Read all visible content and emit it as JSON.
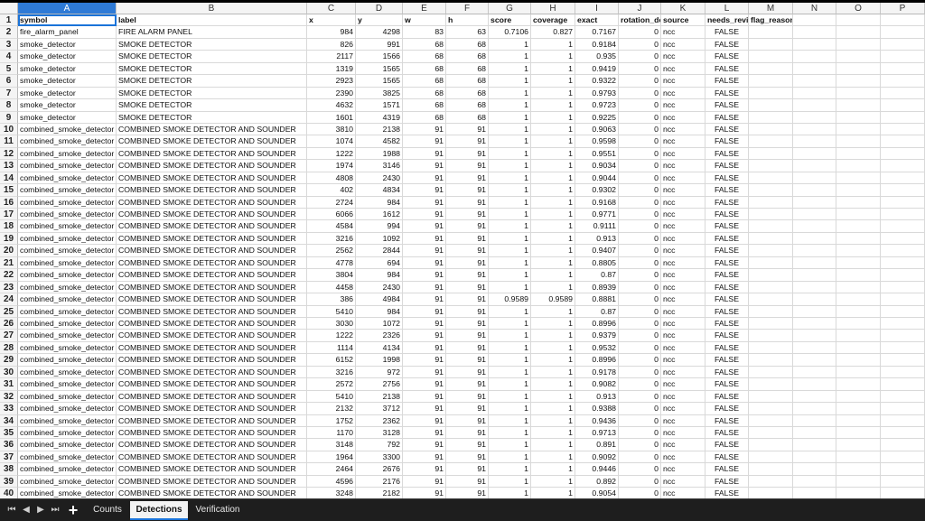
{
  "columns": [
    "A",
    "B",
    "C",
    "D",
    "E",
    "F",
    "G",
    "H",
    "I",
    "J",
    "K",
    "L",
    "M",
    "N",
    "O",
    "P"
  ],
  "selected_column": "A",
  "header_row": [
    "symbol",
    "label",
    "x",
    "y",
    "w",
    "h",
    "score",
    "coverage",
    "exact",
    "rotation_deg",
    "source",
    "needs_review",
    "flag_reason",
    "",
    "",
    ""
  ],
  "rows": [
    [
      "fire_alarm_panel",
      "FIRE ALARM PANEL",
      "984",
      "4298",
      "83",
      "63",
      "0.7106",
      "0.827",
      "0.7167",
      "0",
      "ncc",
      "FALSE"
    ],
    [
      "smoke_detector",
      "SMOKE DETECTOR",
      "826",
      "991",
      "68",
      "68",
      "1",
      "1",
      "0.9184",
      "0",
      "ncc",
      "FALSE"
    ],
    [
      "smoke_detector",
      "SMOKE DETECTOR",
      "2117",
      "1566",
      "68",
      "68",
      "1",
      "1",
      "0.935",
      "0",
      "ncc",
      "FALSE"
    ],
    [
      "smoke_detector",
      "SMOKE DETECTOR",
      "1319",
      "1565",
      "68",
      "68",
      "1",
      "1",
      "0.9419",
      "0",
      "ncc",
      "FALSE"
    ],
    [
      "smoke_detector",
      "SMOKE DETECTOR",
      "2923",
      "1565",
      "68",
      "68",
      "1",
      "1",
      "0.9322",
      "0",
      "ncc",
      "FALSE"
    ],
    [
      "smoke_detector",
      "SMOKE DETECTOR",
      "2390",
      "3825",
      "68",
      "68",
      "1",
      "1",
      "0.9793",
      "0",
      "ncc",
      "FALSE"
    ],
    [
      "smoke_detector",
      "SMOKE DETECTOR",
      "4632",
      "1571",
      "68",
      "68",
      "1",
      "1",
      "0.9723",
      "0",
      "ncc",
      "FALSE"
    ],
    [
      "smoke_detector",
      "SMOKE DETECTOR",
      "1601",
      "4319",
      "68",
      "68",
      "1",
      "1",
      "0.9225",
      "0",
      "ncc",
      "FALSE"
    ],
    [
      "combined_smoke_detector",
      "COMBINED SMOKE DETECTOR AND SOUNDER",
      "3810",
      "2138",
      "91",
      "91",
      "1",
      "1",
      "0.9063",
      "0",
      "ncc",
      "FALSE"
    ],
    [
      "combined_smoke_detector",
      "COMBINED SMOKE DETECTOR AND SOUNDER",
      "1074",
      "4582",
      "91",
      "91",
      "1",
      "1",
      "0.9598",
      "0",
      "ncc",
      "FALSE"
    ],
    [
      "combined_smoke_detector",
      "COMBINED SMOKE DETECTOR AND SOUNDER",
      "1222",
      "1988",
      "91",
      "91",
      "1",
      "1",
      "0.9551",
      "0",
      "ncc",
      "FALSE"
    ],
    [
      "combined_smoke_detector",
      "COMBINED SMOKE DETECTOR AND SOUNDER",
      "1974",
      "3146",
      "91",
      "91",
      "1",
      "1",
      "0.9034",
      "0",
      "ncc",
      "FALSE"
    ],
    [
      "combined_smoke_detector",
      "COMBINED SMOKE DETECTOR AND SOUNDER",
      "4808",
      "2430",
      "91",
      "91",
      "1",
      "1",
      "0.9044",
      "0",
      "ncc",
      "FALSE"
    ],
    [
      "combined_smoke_detector",
      "COMBINED SMOKE DETECTOR AND SOUNDER",
      "402",
      "4834",
      "91",
      "91",
      "1",
      "1",
      "0.9302",
      "0",
      "ncc",
      "FALSE"
    ],
    [
      "combined_smoke_detector",
      "COMBINED SMOKE DETECTOR AND SOUNDER",
      "2724",
      "984",
      "91",
      "91",
      "1",
      "1",
      "0.9168",
      "0",
      "ncc",
      "FALSE"
    ],
    [
      "combined_smoke_detector",
      "COMBINED SMOKE DETECTOR AND SOUNDER",
      "6066",
      "1612",
      "91",
      "91",
      "1",
      "1",
      "0.9771",
      "0",
      "ncc",
      "FALSE"
    ],
    [
      "combined_smoke_detector",
      "COMBINED SMOKE DETECTOR AND SOUNDER",
      "4584",
      "994",
      "91",
      "91",
      "1",
      "1",
      "0.9111",
      "0",
      "ncc",
      "FALSE"
    ],
    [
      "combined_smoke_detector",
      "COMBINED SMOKE DETECTOR AND SOUNDER",
      "3216",
      "1092",
      "91",
      "91",
      "1",
      "1",
      "0.913",
      "0",
      "ncc",
      "FALSE"
    ],
    [
      "combined_smoke_detector",
      "COMBINED SMOKE DETECTOR AND SOUNDER",
      "2562",
      "2844",
      "91",
      "91",
      "1",
      "1",
      "0.9407",
      "0",
      "ncc",
      "FALSE"
    ],
    [
      "combined_smoke_detector",
      "COMBINED SMOKE DETECTOR AND SOUNDER",
      "4778",
      "694",
      "91",
      "91",
      "1",
      "1",
      "0.8805",
      "0",
      "ncc",
      "FALSE"
    ],
    [
      "combined_smoke_detector",
      "COMBINED SMOKE DETECTOR AND SOUNDER",
      "3804",
      "984",
      "91",
      "91",
      "1",
      "1",
      "0.87",
      "0",
      "ncc",
      "FALSE"
    ],
    [
      "combined_smoke_detector",
      "COMBINED SMOKE DETECTOR AND SOUNDER",
      "4458",
      "2430",
      "91",
      "91",
      "1",
      "1",
      "0.8939",
      "0",
      "ncc",
      "FALSE"
    ],
    [
      "combined_smoke_detector",
      "COMBINED SMOKE DETECTOR AND SOUNDER",
      "386",
      "4984",
      "91",
      "91",
      "0.9589",
      "0.9589",
      "0.8881",
      "0",
      "ncc",
      "FALSE"
    ],
    [
      "combined_smoke_detector",
      "COMBINED SMOKE DETECTOR AND SOUNDER",
      "5410",
      "984",
      "91",
      "91",
      "1",
      "1",
      "0.87",
      "0",
      "ncc",
      "FALSE"
    ],
    [
      "combined_smoke_detector",
      "COMBINED SMOKE DETECTOR AND SOUNDER",
      "3030",
      "1072",
      "91",
      "91",
      "1",
      "1",
      "0.8996",
      "0",
      "ncc",
      "FALSE"
    ],
    [
      "combined_smoke_detector",
      "COMBINED SMOKE DETECTOR AND SOUNDER",
      "1222",
      "2326",
      "91",
      "91",
      "1",
      "1",
      "0.9379",
      "0",
      "ncc",
      "FALSE"
    ],
    [
      "combined_smoke_detector",
      "COMBINED SMOKE DETECTOR AND SOUNDER",
      "1114",
      "4134",
      "91",
      "91",
      "1",
      "1",
      "0.9532",
      "0",
      "ncc",
      "FALSE"
    ],
    [
      "combined_smoke_detector",
      "COMBINED SMOKE DETECTOR AND SOUNDER",
      "6152",
      "1998",
      "91",
      "91",
      "1",
      "1",
      "0.8996",
      "0",
      "ncc",
      "FALSE"
    ],
    [
      "combined_smoke_detector",
      "COMBINED SMOKE DETECTOR AND SOUNDER",
      "3216",
      "972",
      "91",
      "91",
      "1",
      "1",
      "0.9178",
      "0",
      "ncc",
      "FALSE"
    ],
    [
      "combined_smoke_detector",
      "COMBINED SMOKE DETECTOR AND SOUNDER",
      "2572",
      "2756",
      "91",
      "91",
      "1",
      "1",
      "0.9082",
      "0",
      "ncc",
      "FALSE"
    ],
    [
      "combined_smoke_detector",
      "COMBINED SMOKE DETECTOR AND SOUNDER",
      "5410",
      "2138",
      "91",
      "91",
      "1",
      "1",
      "0.913",
      "0",
      "ncc",
      "FALSE"
    ],
    [
      "combined_smoke_detector",
      "COMBINED SMOKE DETECTOR AND SOUNDER",
      "2132",
      "3712",
      "91",
      "91",
      "1",
      "1",
      "0.9388",
      "0",
      "ncc",
      "FALSE"
    ],
    [
      "combined_smoke_detector",
      "COMBINED SMOKE DETECTOR AND SOUNDER",
      "1752",
      "2362",
      "91",
      "91",
      "1",
      "1",
      "0.9436",
      "0",
      "ncc",
      "FALSE"
    ],
    [
      "combined_smoke_detector",
      "COMBINED SMOKE DETECTOR AND SOUNDER",
      "1170",
      "3128",
      "91",
      "91",
      "1",
      "1",
      "0.9713",
      "0",
      "ncc",
      "FALSE"
    ],
    [
      "combined_smoke_detector",
      "COMBINED SMOKE DETECTOR AND SOUNDER",
      "3148",
      "792",
      "91",
      "91",
      "1",
      "1",
      "0.891",
      "0",
      "ncc",
      "FALSE"
    ],
    [
      "combined_smoke_detector",
      "COMBINED SMOKE DETECTOR AND SOUNDER",
      "1964",
      "3300",
      "91",
      "91",
      "1",
      "1",
      "0.9092",
      "0",
      "ncc",
      "FALSE"
    ],
    [
      "combined_smoke_detector",
      "COMBINED SMOKE DETECTOR AND SOUNDER",
      "2464",
      "2676",
      "91",
      "91",
      "1",
      "1",
      "0.9446",
      "0",
      "ncc",
      "FALSE"
    ],
    [
      "combined_smoke_detector",
      "COMBINED SMOKE DETECTOR AND SOUNDER",
      "4596",
      "2176",
      "91",
      "91",
      "1",
      "1",
      "0.892",
      "0",
      "ncc",
      "FALSE"
    ],
    [
      "combined_smoke_detector",
      "COMBINED SMOKE DETECTOR AND SOUNDER",
      "3248",
      "2182",
      "91",
      "91",
      "1",
      "1",
      "0.9054",
      "0",
      "ncc",
      "FALSE"
    ]
  ],
  "tabs": [
    "Counts",
    "Detections",
    "Verification"
  ],
  "active_tab": "Detections",
  "icons": {
    "first": "first-sheet-icon",
    "prev": "prev-sheet-icon",
    "next": "next-sheet-icon",
    "last": "last-sheet-icon",
    "add": "add-sheet-icon"
  },
  "colors": {
    "selection": "#2e7ad6",
    "tabbar": "#1e1e1e"
  }
}
